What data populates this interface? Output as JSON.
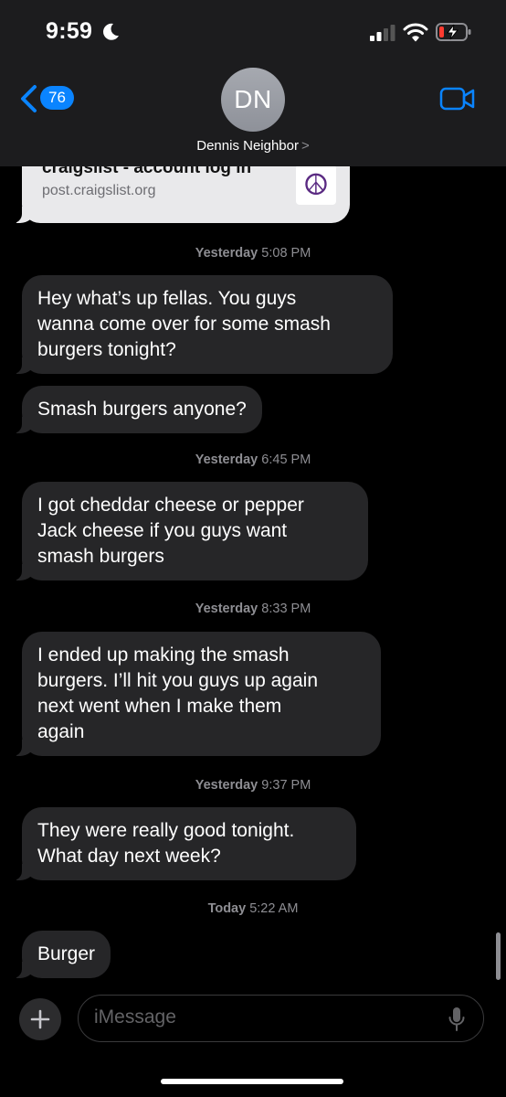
{
  "status_bar": {
    "time": "9:59",
    "icons": [
      "moon-icon",
      "signal-icon",
      "wifi-icon",
      "battery-charging-icon"
    ]
  },
  "header": {
    "back_badge": "76",
    "avatar_initials": "DN",
    "contact_name": "Dennis Neighbor",
    "contact_chevron": ">",
    "icons": [
      "chevron-left-icon",
      "video-camera-icon"
    ],
    "accent_color": "#0a84ff"
  },
  "link_preview": {
    "title": "craigslist - account log in",
    "domain": "post.craigslist.org",
    "thumbnail": "☮"
  },
  "messages": [
    {
      "type": "timestamp",
      "day": "Yesterday",
      "time": "5:08 PM"
    },
    {
      "type": "incoming",
      "lines": [
        "Hey what’s up fellas. You guys",
        "wanna come over for some smash",
        "burgers tonight?"
      ]
    },
    {
      "type": "incoming",
      "lines": [
        "Smash burgers anyone?"
      ]
    },
    {
      "type": "timestamp",
      "day": "Yesterday",
      "time": "6:45 PM"
    },
    {
      "type": "incoming",
      "lines": [
        "I got cheddar cheese or pepper",
        "Jack cheese if you guys want",
        "smash burgers"
      ]
    },
    {
      "type": "timestamp",
      "day": "Yesterday",
      "time": "8:33 PM"
    },
    {
      "type": "incoming",
      "lines": [
        "I ended up making the smash",
        "burgers. I’ll hit you guys up again",
        "next went when I make them",
        "again"
      ]
    },
    {
      "type": "timestamp",
      "day": "Yesterday",
      "time": "9:37 PM"
    },
    {
      "type": "incoming",
      "lines": [
        "They were really good tonight.",
        "What day next week?"
      ]
    },
    {
      "type": "timestamp",
      "day": "Today",
      "time": "5:22 AM"
    },
    {
      "type": "incoming",
      "lines": [
        "Burger"
      ]
    }
  ],
  "compose": {
    "placeholder": "iMessage",
    "add_label": "+",
    "icons": [
      "plus-icon",
      "microphone-icon"
    ]
  },
  "colors": {
    "background": "#000000",
    "bubble_incoming": "#262628",
    "header": "#1c1c1e",
    "timestamp": "#8e8e93"
  }
}
